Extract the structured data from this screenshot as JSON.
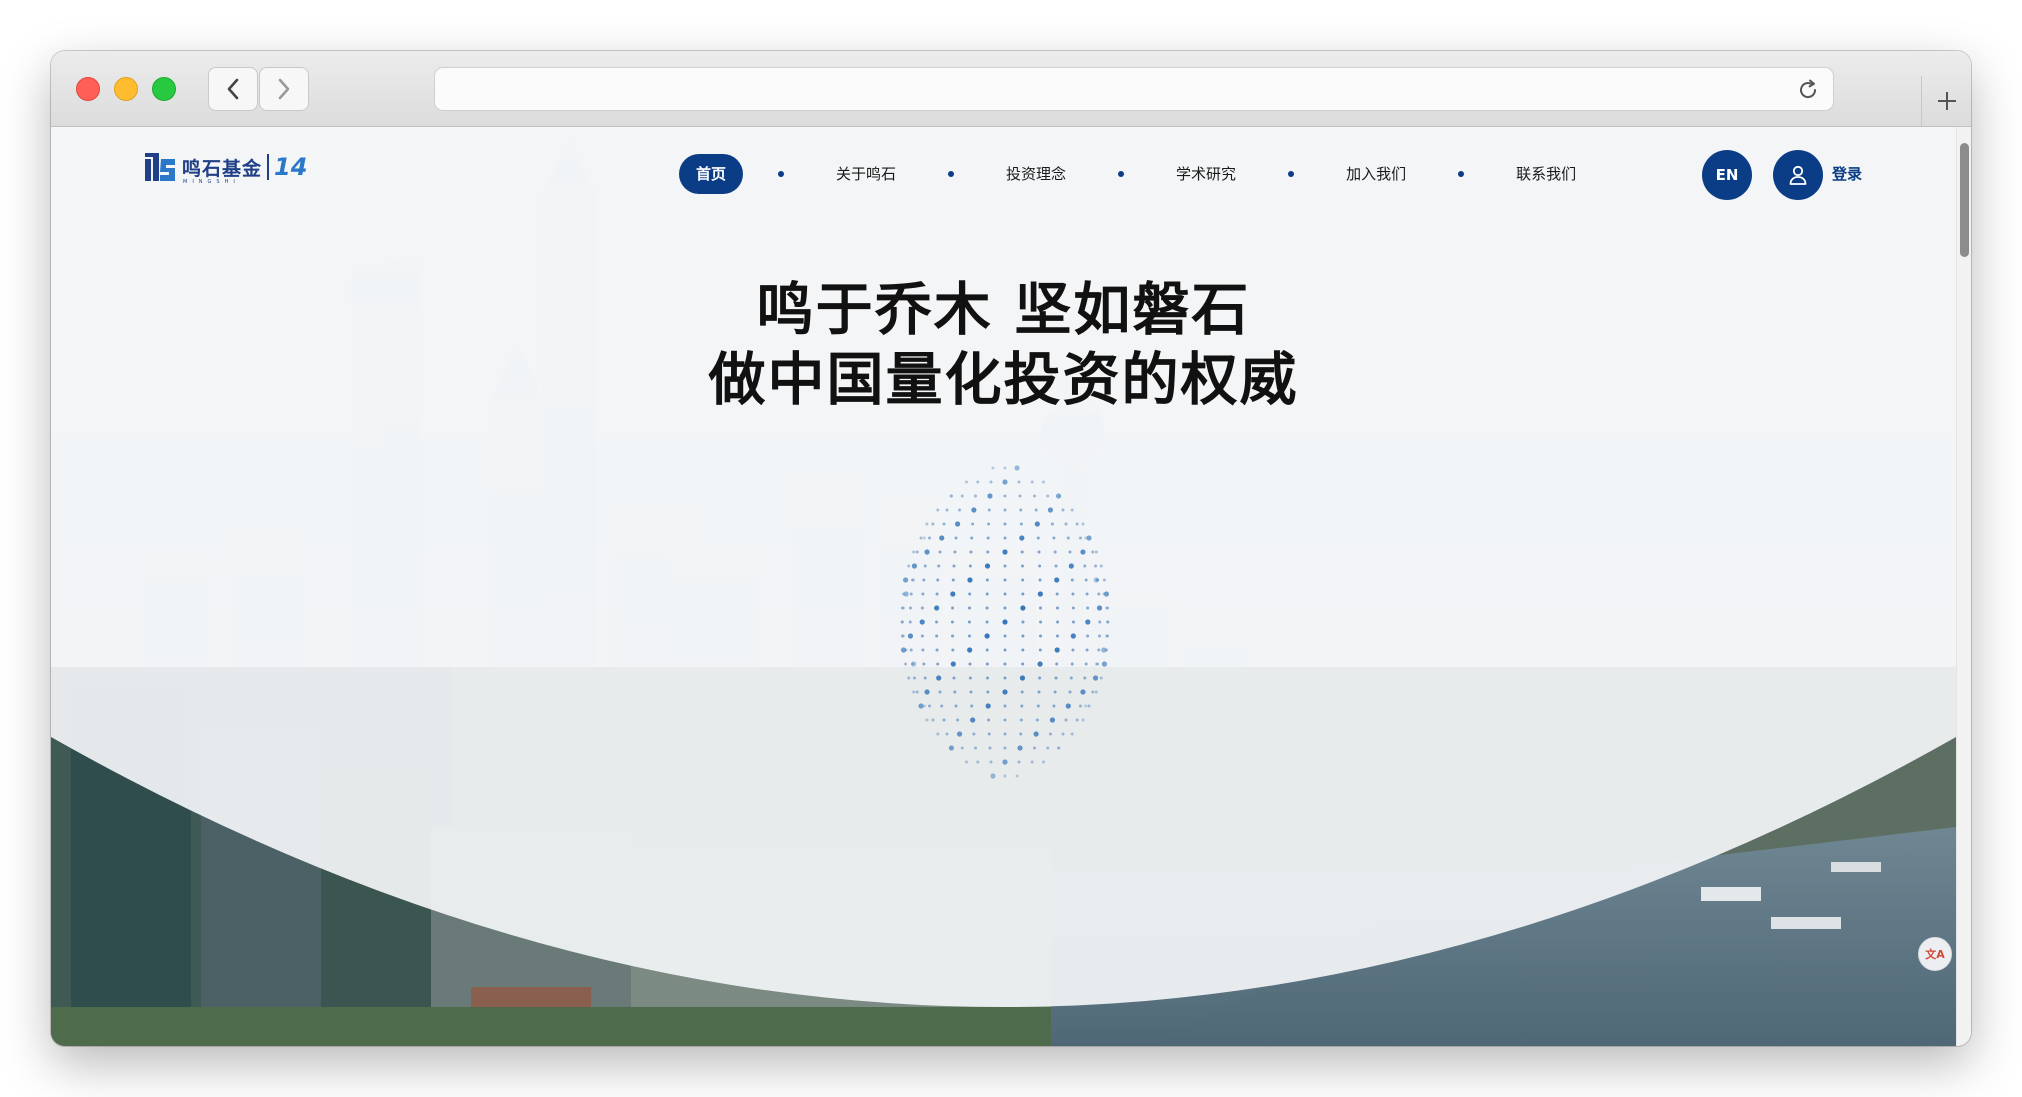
{
  "browser": {
    "url": "",
    "back_icon": "chevron-left-icon",
    "forward_icon": "chevron-right-icon",
    "reload_icon": "reload-icon",
    "new_tab_icon": "plus-icon"
  },
  "site": {
    "logo_text": "鸣石基金",
    "logo_subtext": "MINGSHI",
    "logo_number": "14",
    "nav": [
      {
        "label": "首页",
        "active": true
      },
      {
        "label": "关于鸣石",
        "active": false
      },
      {
        "label": "投资理念",
        "active": false
      },
      {
        "label": "学术研究",
        "active": false
      },
      {
        "label": "加入我们",
        "active": false
      },
      {
        "label": "联系我们",
        "active": false
      }
    ],
    "lang_label": "EN",
    "login_label": "登录",
    "user_icon": "user-icon"
  },
  "hero": {
    "line1": "鸣于乔木 坚如磐石",
    "line2": "做中国量化投资的权威"
  },
  "colors": {
    "brand": "#0a3d85",
    "accent_blue": "#2b78c9"
  },
  "floating_widget": {
    "icon": "translate-icon",
    "label": "文A"
  }
}
